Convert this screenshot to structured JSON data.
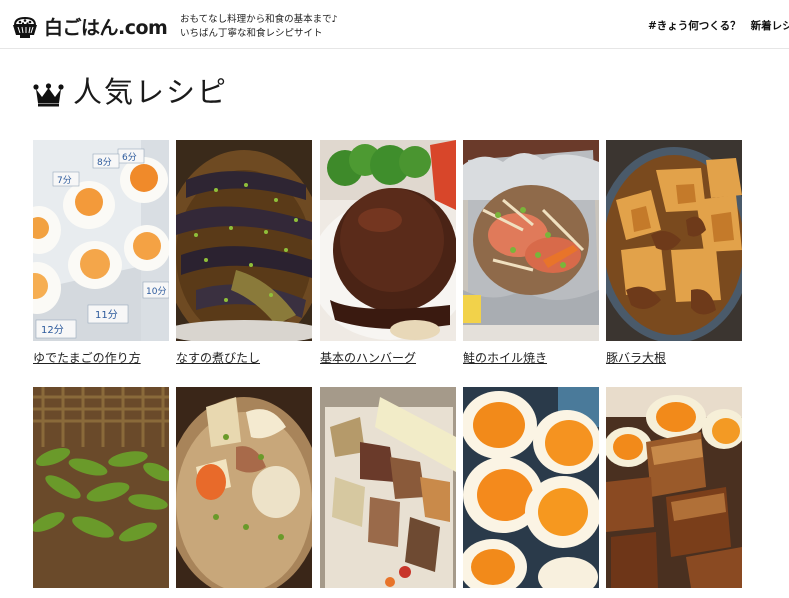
{
  "header": {
    "logo_text": "白ごはん.com",
    "tagline_line1": "おもてなし料理から和食の基本まで♪",
    "tagline_line2": "いちばん丁寧な和食レシピサイト",
    "nav": [
      {
        "label": "#きょう何つくる？"
      },
      {
        "label": "新着レシピ"
      }
    ]
  },
  "section": {
    "title": "人気レシピ"
  },
  "recipes": [
    {
      "title": "ゆでたまごの作り方"
    },
    {
      "title": "なすの煮びたし"
    },
    {
      "title": "基本のハンバーグ"
    },
    {
      "title": "鮭のホイル焼き"
    },
    {
      "title": "豚バラ大根"
    },
    {
      "title": ""
    },
    {
      "title": ""
    },
    {
      "title": ""
    },
    {
      "title": ""
    },
    {
      "title": ""
    }
  ],
  "photo_labels": {
    "egg_times": [
      "6分",
      "7分",
      "8分",
      "10分",
      "11分",
      "12分"
    ]
  }
}
